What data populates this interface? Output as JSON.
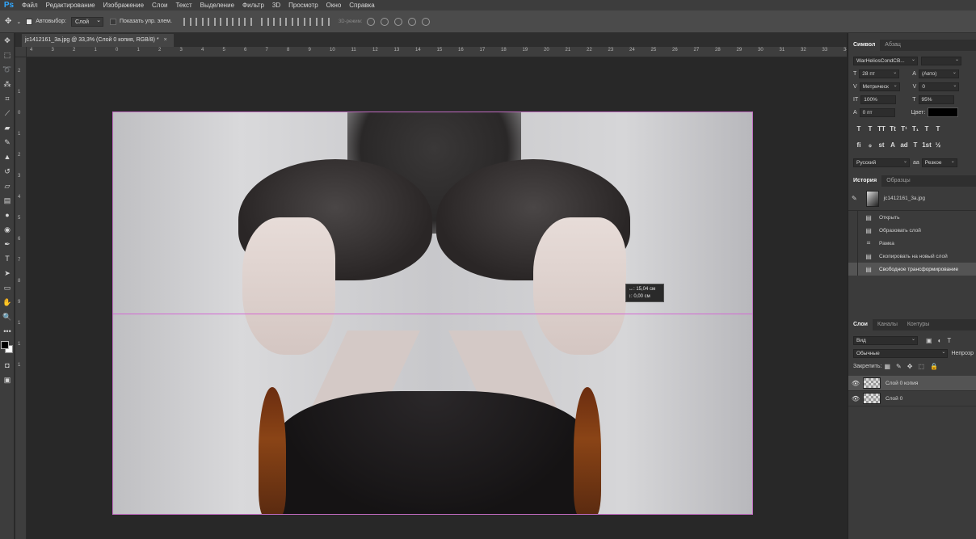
{
  "app": {
    "logo": "Ps"
  },
  "menu": [
    "Файл",
    "Редактирование",
    "Изображение",
    "Слои",
    "Текст",
    "Выделение",
    "Фильтр",
    "3D",
    "Просмотр",
    "Окно",
    "Справка"
  ],
  "options": {
    "autoselect_label": "Автовыбор:",
    "autoselect_value": "Слой",
    "show_controls_label": "Показать упр. элем.",
    "mode_3d": "3D-режим:"
  },
  "document": {
    "tab_title": "jc1412161_3a.jpg @ 33,3% (Слой 0 копия, RGB/8) *",
    "close": "×"
  },
  "rulers": {
    "h": [
      "4",
      "3",
      "2",
      "1",
      "0",
      "1",
      "2",
      "3",
      "4",
      "5",
      "6",
      "7",
      "8",
      "9",
      "10",
      "11",
      "12",
      "13",
      "14",
      "15",
      "16",
      "17",
      "18",
      "19",
      "20",
      "21",
      "22",
      "23",
      "24",
      "25",
      "26",
      "27",
      "28",
      "29",
      "30",
      "31",
      "32",
      "33",
      "34",
      "35",
      "36",
      "37"
    ],
    "v": [
      "2",
      "1",
      "0",
      "1",
      "2",
      "3",
      "4",
      "5",
      "6",
      "7",
      "8",
      "9",
      "1",
      "1",
      "1"
    ]
  },
  "measure": {
    "w": "↔:  15,04 см",
    "h": "↕:    0,00 см"
  },
  "character": {
    "tabs": [
      "Символ",
      "Абзац"
    ],
    "font_family": "WarHeliosCondCB...",
    "font_style": "",
    "size": "28 пт",
    "leading": "(Авто)",
    "kerning": "Метрическ",
    "tracking": "0",
    "vscale": "100%",
    "hscale": "95%",
    "baseline": "0 пт",
    "color_label": "Цвет:",
    "color": "#000000",
    "style_glyphs": [
      "T",
      "T",
      "TT",
      "Tt",
      "T¹",
      "T₁",
      "T",
      "T"
    ],
    "ot_glyphs": [
      "fi",
      "ℴ",
      "st",
      "A",
      "ad",
      "T",
      "1st",
      "½"
    ],
    "language": "Русский",
    "antialias": "Резкое",
    "aa_prefix": "aa"
  },
  "history": {
    "tabs": [
      "История",
      "Образцы"
    ],
    "snapshot": "jc1412161_3a.jpg",
    "items": [
      "Открыть",
      "Образовать слой",
      "Рамка",
      "Скопировать на новый слой",
      "Свободное трансформирование"
    ]
  },
  "layers": {
    "tabs": [
      "Слои",
      "Каналы",
      "Контуры"
    ],
    "kind": "Вид",
    "blend": "Обычные",
    "opacity_label": "Непрозр",
    "lock_label": "Закрепить:",
    "items": [
      {
        "name": "Слой 0 копия",
        "selected": true
      },
      {
        "name": "Слой 0",
        "selected": false
      }
    ]
  }
}
